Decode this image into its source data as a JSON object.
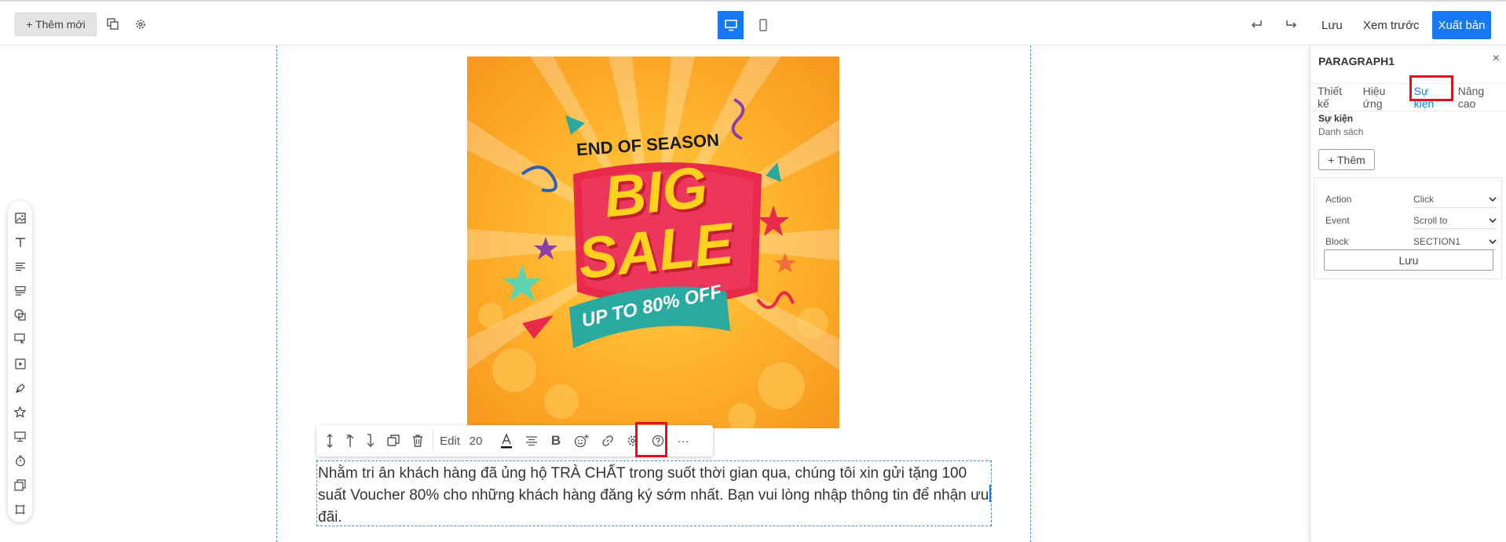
{
  "topbar": {
    "add_new_label": "+ Thêm mới",
    "undo_icon": "undo-icon",
    "redo_icon": "redo-icon",
    "save_label": "Lưu",
    "preview_label": "Xem trước",
    "publish_label": "Xuất bản",
    "active_color": "#1877f2"
  },
  "banner": {
    "line1": "END OF SEASON",
    "line2": "BIG",
    "line3": "SALE",
    "line4": "UP TO 80% OFF"
  },
  "text_toolbar": {
    "edit_label": "Edit",
    "font_size": "20",
    "more_label": "···"
  },
  "paragraph": {
    "text": "Nhằm tri ân khách hàng đã ủng hộ TRÀ CHẤT trong suốt thời gian qua, chúng tôi xin gửi tặng 100 suất Voucher 80% cho những khách hàng đăng ký sớm nhất. Bạn vui lòng nhập thông tin để nhận ưu đãi."
  },
  "panel": {
    "title": "PARAGRAPH1",
    "close": "×",
    "tabs": [
      "Thiết kế",
      "Hiệu ứng",
      "Sự kiện",
      "Nâng cao"
    ],
    "section_title": "Sự kiện",
    "section_sub": "Danh sách",
    "add_label": "+ Thêm",
    "rows": [
      {
        "label": "Action",
        "value": "Click"
      },
      {
        "label": "Event",
        "value": "Scroll to"
      },
      {
        "label": "Block",
        "value": "SECTION1"
      }
    ],
    "save_label": "Lưu"
  }
}
